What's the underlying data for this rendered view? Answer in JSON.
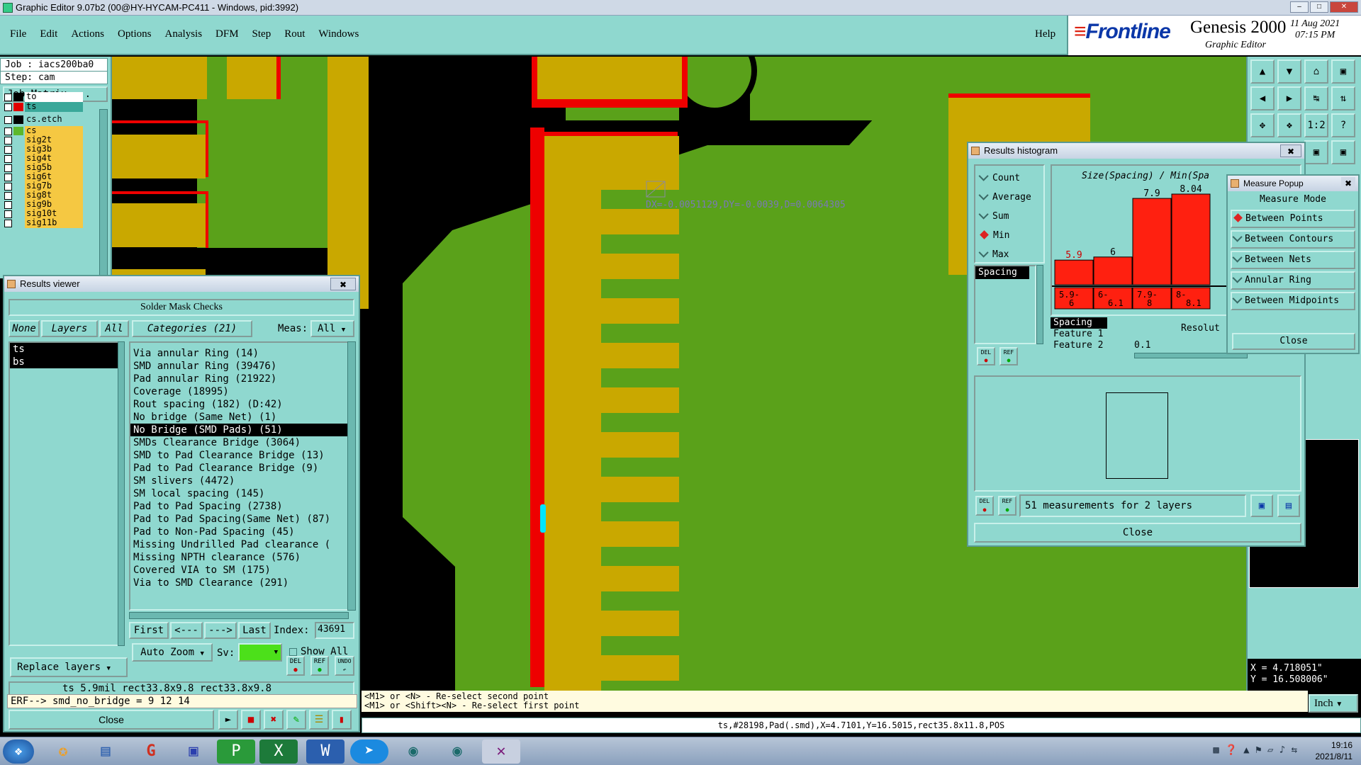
{
  "window": {
    "title": "Graphic Editor 9.07b2 (00@HY-HYCAM-PC411 - Windows, pid:3992)",
    "minimize": "–",
    "maximize": "□",
    "close": "✕"
  },
  "menu": [
    "File",
    "Edit",
    "Actions",
    "Options",
    "Analysis",
    "DFM",
    "Step",
    "Rout",
    "Windows"
  ],
  "help": "Help",
  "brand": {
    "logo": "Frontline",
    "product": "Genesis 2000",
    "subtitle": "Graphic Editor",
    "date": "11 Aug 2021",
    "time": "07:15 PM"
  },
  "job": {
    "job": "Job : iacs200ba0",
    "step": "Step: cam",
    "matrix": "Job Matrix ..."
  },
  "layers": [
    {
      "name": "to",
      "color": "#ffffff",
      "swatch": "#000000"
    },
    {
      "name": "ts",
      "color": "#3aa89a",
      "swatch": "#e00000"
    },
    {
      "name": "cs.etch",
      "color": "#8fd8cf",
      "swatch": "#000000"
    },
    {
      "name": "cs",
      "color": "#f5c842",
      "swatch": "#5cb82c"
    },
    {
      "name": "sig2t",
      "color": "#f5c842",
      "swatch": "#8fd8cf"
    },
    {
      "name": "sig3b",
      "color": "#f5c842",
      "swatch": "#8fd8cf"
    },
    {
      "name": "sig4t",
      "color": "#f5c842",
      "swatch": "#8fd8cf"
    },
    {
      "name": "sig5b",
      "color": "#f5c842",
      "swatch": "#8fd8cf"
    },
    {
      "name": "sig6t",
      "color": "#f5c842",
      "swatch": "#8fd8cf"
    },
    {
      "name": "sig7b",
      "color": "#f5c842",
      "swatch": "#8fd8cf"
    },
    {
      "name": "sig8t",
      "color": "#f5c842",
      "swatch": "#8fd8cf"
    },
    {
      "name": "sig9b",
      "color": "#f5c842",
      "swatch": "#8fd8cf"
    },
    {
      "name": "sig10t",
      "color": "#f5c842",
      "swatch": "#8fd8cf"
    },
    {
      "name": "sig11b",
      "color": "#f5c842",
      "swatch": "#8fd8cf"
    }
  ],
  "measure_text": "DX=-0.0051129,DY=-0.0039,D=0.0064305",
  "results_viewer": {
    "title": "Results viewer",
    "heading": "Solder Mask Checks",
    "none": "None",
    "layers": "Layers",
    "all": "All",
    "categories": "Categories (21)",
    "meas_label": "Meas:",
    "meas_value": "All",
    "layer_list": [
      "ts",
      "bs"
    ],
    "items": [
      "Via annular Ring (14)",
      "SMD annular Ring (39476)",
      "Pad annular Ring (21922)",
      "Coverage (18995)",
      "Rout spacing (182)       (D:42)",
      "No bridge (Same Net) (1)",
      "No Bridge (SMD Pads) (51)",
      "SMDs Clearance Bridge (3064)",
      "SMD to Pad Clearance Bridge (13)",
      "Pad to Pad Clearance Bridge (9)",
      "SM slivers (4472)",
      "SM local spacing (145)",
      "Pad to Pad Spacing (2738)",
      "Pad to Pad Spacing(Same Net) (87)",
      "Pad to Non-Pad Spacing (45)",
      "Missing Undrilled Pad clearance (",
      "Missing NPTH clearance (576)",
      "Covered VIA to SM (175)",
      "Via to SMD Clearance (291)"
    ],
    "selected_index": 6,
    "first": "First",
    "prev": "<---",
    "next": "--->",
    "last": "Last",
    "index_label": "Index:",
    "index_value": "43691",
    "auto_zoom": "Auto Zoom",
    "sv": "Sv:",
    "show_all": "Show All",
    "replace_layers": "Replace layers",
    "del": "DEL",
    "ref": "REF",
    "undo": "UNDO",
    "info": "ts 5.9mil  rect33.8x9.8  rect33.8x9.8",
    "erf": "ERF--> smd_no_bridge = 9 12 14",
    "close": "Close"
  },
  "histogram": {
    "title": "Results histogram",
    "options": [
      {
        "label": "Count",
        "state": "check"
      },
      {
        "label": "Average",
        "state": "check"
      },
      {
        "label": "Sum",
        "state": "check"
      },
      {
        "label": "Min",
        "state": "selected"
      },
      {
        "label": "Max",
        "state": "check"
      }
    ],
    "chart_title": "Size(Spacing) / Min(Spa",
    "list_item": "Spacing",
    "props": [
      "Spacing",
      "Feature 1",
      "Feature 2"
    ],
    "resolution_label": "Resolut",
    "resolution_value": "0.1",
    "status": "51 measurements for 2 layers",
    "close": "Close",
    "del": "DEL",
    "ref": "REF"
  },
  "chart_data": {
    "type": "bar",
    "title": "Size(Spacing) / Min(Spa",
    "categories": [
      "5.9-6",
      "6-6.1",
      "7.9-8",
      "8-8.1"
    ],
    "category_lines": [
      [
        "5.9-",
        "6"
      ],
      [
        "6-",
        "6.1"
      ],
      [
        "7.9-",
        "8"
      ],
      [
        "8-",
        "8.1"
      ]
    ],
    "values": [
      5.9,
      6,
      7.9,
      8.04
    ],
    "value_labels": [
      "5.9",
      "6",
      "7.9",
      "8.04"
    ],
    "ylim": [
      0,
      8.04
    ],
    "bar_color": "#ff2010",
    "selected_bar_label_color": "#cc0000"
  },
  "measure_popup": {
    "title": "Measure Popup",
    "heading": "Measure Mode",
    "modes": [
      {
        "label": "Between Points",
        "state": "selected"
      },
      {
        "label": "Between Contours",
        "state": "check"
      },
      {
        "label": "Between Nets",
        "state": "check"
      },
      {
        "label": "Annular Ring",
        "state": "check"
      },
      {
        "label": "Between Midpoints",
        "state": "check"
      }
    ],
    "close": "Close"
  },
  "cursor": {
    "x": "X = 4.718051\"",
    "y": "Y = 16.508006\""
  },
  "units": "Inch",
  "cmd": [
    "<M1> or <N> - Re-select second point",
    "<M1> or <Shift><N> - Re-select first point"
  ],
  "status": "ts,#28198,Pad(.smd),X=4.7101,Y=16.5015,rect35.8x11.8,POS",
  "taskbar": {
    "time": "19:16",
    "date": "2021/8/11"
  }
}
